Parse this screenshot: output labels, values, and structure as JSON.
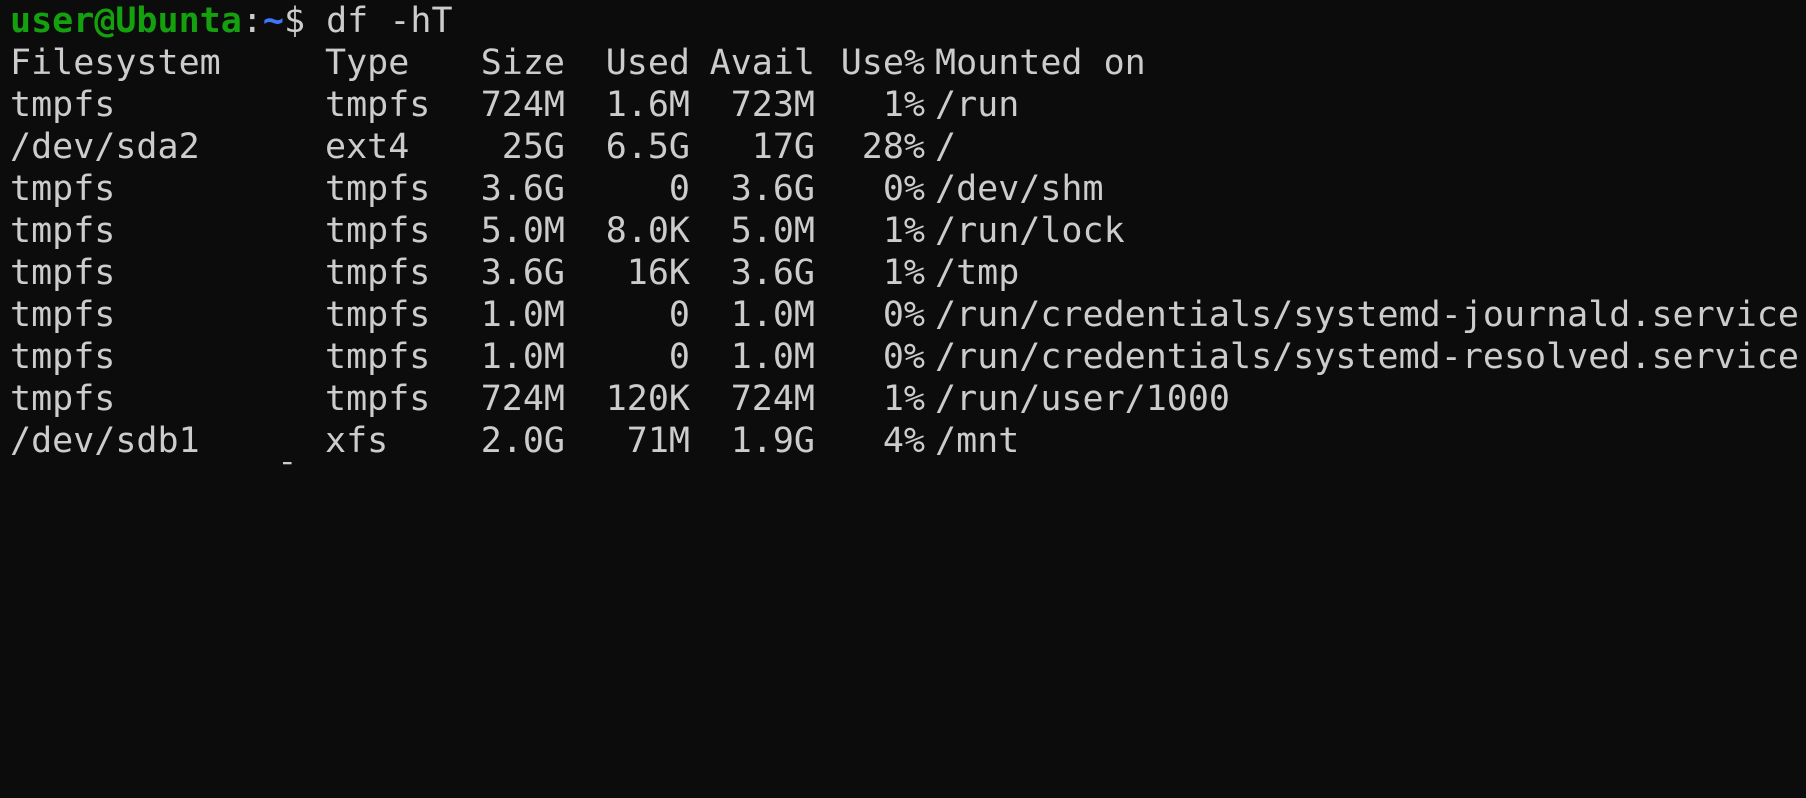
{
  "prompt": {
    "user_host": "user@Ubunta",
    "colon": ":",
    "path": "~",
    "dollar": "$",
    "command": " df -hT"
  },
  "table": {
    "headers": {
      "filesystem": "Filesystem",
      "type": "Type",
      "size": "Size",
      "used": "Used",
      "avail": "Avail",
      "use_pct": "Use%",
      "mounted_on": "Mounted on"
    },
    "rows": [
      {
        "filesystem": "tmpfs",
        "type": "tmpfs",
        "size": "724M",
        "used": "1.6M",
        "avail": "723M",
        "use_pct": "1%",
        "mounted_on": "/run"
      },
      {
        "filesystem": "/dev/sda2",
        "type": "ext4",
        "size": "25G",
        "used": "6.5G",
        "avail": "17G",
        "use_pct": "28%",
        "mounted_on": "/"
      },
      {
        "filesystem": "tmpfs",
        "type": "tmpfs",
        "size": "3.6G",
        "used": "0",
        "avail": "3.6G",
        "use_pct": "0%",
        "mounted_on": "/dev/shm"
      },
      {
        "filesystem": "tmpfs",
        "type": "tmpfs",
        "size": "5.0M",
        "used": "8.0K",
        "avail": "5.0M",
        "use_pct": "1%",
        "mounted_on": "/run/lock"
      },
      {
        "filesystem": "tmpfs",
        "type": "tmpfs",
        "size": "3.6G",
        "used": "16K",
        "avail": "3.6G",
        "use_pct": "1%",
        "mounted_on": "/tmp"
      },
      {
        "filesystem": "tmpfs",
        "type": "tmpfs",
        "size": "1.0M",
        "used": "0",
        "avail": "1.0M",
        "use_pct": "0%",
        "mounted_on": "/run/credentials/systemd-journald.service"
      },
      {
        "filesystem": "tmpfs",
        "type": "tmpfs",
        "size": "1.0M",
        "used": "0",
        "avail": "1.0M",
        "use_pct": "0%",
        "mounted_on": "/run/credentials/systemd-resolved.service"
      },
      {
        "filesystem": "tmpfs",
        "type": "tmpfs",
        "size": "724M",
        "used": "120K",
        "avail": "724M",
        "use_pct": "1%",
        "mounted_on": "/run/user/1000"
      },
      {
        "filesystem": "/dev/sdb1",
        "type": "xfs",
        "size": "2.0G",
        "used": "71M",
        "avail": "1.9G",
        "use_pct": "4%",
        "mounted_on": "/mnt"
      }
    ]
  },
  "colors": {
    "background": "#0c0c0c",
    "foreground": "#cccccc",
    "user_host": "#13a10e",
    "path": "#3b78ff"
  }
}
